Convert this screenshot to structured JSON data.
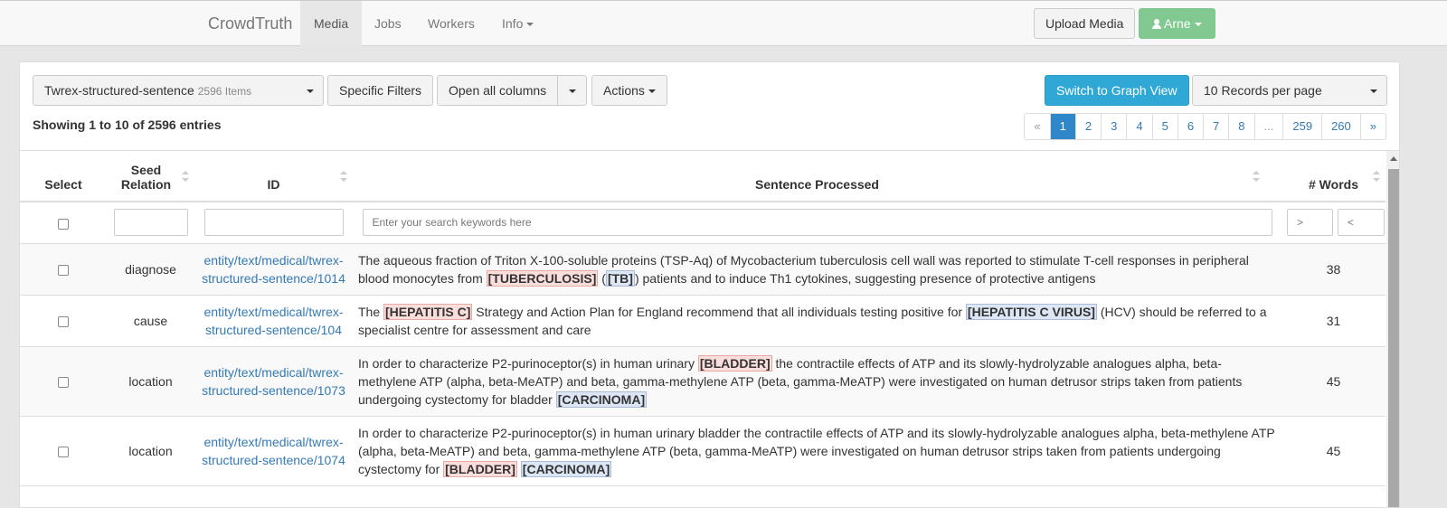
{
  "navbar": {
    "brand": "CrowdTruth",
    "items": [
      {
        "label": "Media",
        "active": true
      },
      {
        "label": "Jobs"
      },
      {
        "label": "Workers"
      },
      {
        "label": "Info"
      }
    ],
    "upload_label": "Upload Media",
    "user_label": "Arne"
  },
  "toolbar": {
    "collection_label": "Twrex-structured-sentence",
    "collection_count": "2596 Items",
    "filters_label": "Specific Filters",
    "columns_label": "Open all columns",
    "actions_label": "Actions",
    "graph_label": "Switch to Graph View",
    "per_page_label": "10 Records per page"
  },
  "showing_text": "Showing 1 to 10 of 2596 entries",
  "pagination": [
    "«",
    "1",
    "2",
    "3",
    "4",
    "5",
    "6",
    "7",
    "8",
    "...",
    "259",
    "260",
    "»"
  ],
  "table": {
    "headers": {
      "select": "Select",
      "seed_relation": "Seed Relation",
      "id": "ID",
      "sentence": "Sentence Processed",
      "words": "# Words"
    },
    "filters": {
      "sentence_placeholder": "Enter your search keywords here",
      "words_gt_placeholder": ">",
      "words_lt_placeholder": "<"
    },
    "rows": [
      {
        "relation": "diagnose",
        "id": "entity/text/medical/twrex-structured-sentence/1014",
        "sentence": [
          {
            "t": "The aqueous fraction of Triton X-100-soluble proteins (TSP-Aq) of Mycobacterium tuberculosis cell wall was reported to stimulate T-cell responses in peripheral blood monocytes from "
          },
          {
            "t": "[TUBERCULOSIS]",
            "hl": "red"
          },
          {
            "t": " ("
          },
          {
            "t": "[TB]",
            "hl": "blue"
          },
          {
            "t": ") patients and to induce Th1 cytokines, suggesting presence of protective antigens"
          }
        ],
        "words": "38"
      },
      {
        "relation": "cause",
        "id": "entity/text/medical/twrex-structured-sentence/104",
        "sentence": [
          {
            "t": "The "
          },
          {
            "t": "[HEPATITIS C]",
            "hl": "red"
          },
          {
            "t": " Strategy and Action Plan for England recommend that all individuals testing positive for "
          },
          {
            "t": "[HEPATITIS C VIRUS]",
            "hl": "blue"
          },
          {
            "t": " (HCV) should be referred to a specialist centre for assessment and care"
          }
        ],
        "words": "31"
      },
      {
        "relation": "location",
        "id": "entity/text/medical/twrex-structured-sentence/1073",
        "sentence": [
          {
            "t": "In order to characterize P2-purinoceptor(s) in human urinary "
          },
          {
            "t": "[BLADDER]",
            "hl": "red"
          },
          {
            "t": " the contractile effects of ATP and its slowly-hydrolyzable analogues alpha, beta-methylene ATP (alpha, beta-MeATP) and beta, gamma-methylene ATP (beta, gamma-MeATP) were investigated on human detrusor strips taken from patients undergoing cystectomy for bladder "
          },
          {
            "t": "[CARCINOMA]",
            "hl": "blue"
          }
        ],
        "words": "45"
      },
      {
        "relation": "location",
        "id": "entity/text/medical/twrex-structured-sentence/1074",
        "sentence": [
          {
            "t": "In order to characterize P2-purinoceptor(s) in human urinary bladder the contractile effects of ATP and its slowly-hydrolyzable analogues alpha, beta-methylene ATP (alpha, beta-MeATP) and beta, gamma-methylene ATP (beta, gamma-MeATP) were investigated on human detrusor strips taken from patients undergoing cystectomy for "
          },
          {
            "t": "[BLADDER]",
            "hl": "red"
          },
          {
            "t": " "
          },
          {
            "t": "[CARCINOMA]",
            "hl": "blue"
          }
        ],
        "words": "45"
      }
    ]
  },
  "colors": {
    "primary": "#2fa8d6",
    "success": "#82c991",
    "link": "#337ab7",
    "highlight_red": "#f9dedc",
    "highlight_blue": "#dde6f4"
  }
}
